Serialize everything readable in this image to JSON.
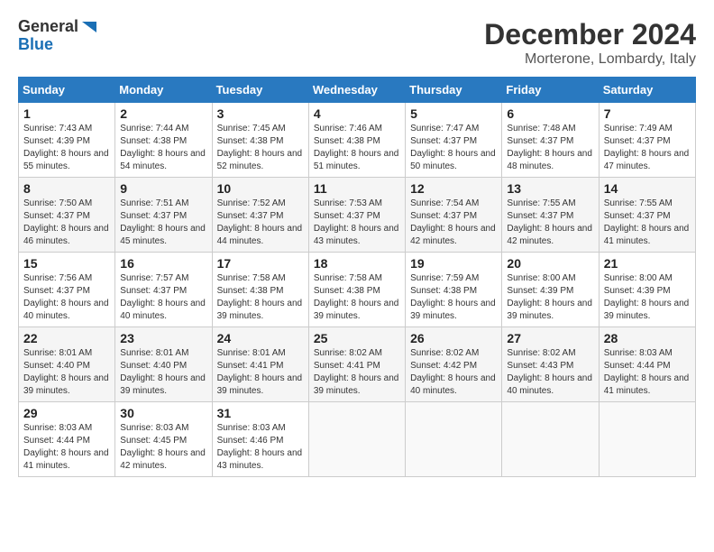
{
  "logo": {
    "line1": "General",
    "line2": "Blue"
  },
  "title": {
    "month_year": "December 2024",
    "location": "Morterone, Lombardy, Italy"
  },
  "weekdays": [
    "Sunday",
    "Monday",
    "Tuesday",
    "Wednesday",
    "Thursday",
    "Friday",
    "Saturday"
  ],
  "weeks": [
    [
      {
        "day": "1",
        "sunrise": "7:43 AM",
        "sunset": "4:39 PM",
        "daylight": "8 hours and 55 minutes."
      },
      {
        "day": "2",
        "sunrise": "7:44 AM",
        "sunset": "4:38 PM",
        "daylight": "8 hours and 54 minutes."
      },
      {
        "day": "3",
        "sunrise": "7:45 AM",
        "sunset": "4:38 PM",
        "daylight": "8 hours and 52 minutes."
      },
      {
        "day": "4",
        "sunrise": "7:46 AM",
        "sunset": "4:38 PM",
        "daylight": "8 hours and 51 minutes."
      },
      {
        "day": "5",
        "sunrise": "7:47 AM",
        "sunset": "4:37 PM",
        "daylight": "8 hours and 50 minutes."
      },
      {
        "day": "6",
        "sunrise": "7:48 AM",
        "sunset": "4:37 PM",
        "daylight": "8 hours and 48 minutes."
      },
      {
        "day": "7",
        "sunrise": "7:49 AM",
        "sunset": "4:37 PM",
        "daylight": "8 hours and 47 minutes."
      }
    ],
    [
      {
        "day": "8",
        "sunrise": "7:50 AM",
        "sunset": "4:37 PM",
        "daylight": "8 hours and 46 minutes."
      },
      {
        "day": "9",
        "sunrise": "7:51 AM",
        "sunset": "4:37 PM",
        "daylight": "8 hours and 45 minutes."
      },
      {
        "day": "10",
        "sunrise": "7:52 AM",
        "sunset": "4:37 PM",
        "daylight": "8 hours and 44 minutes."
      },
      {
        "day": "11",
        "sunrise": "7:53 AM",
        "sunset": "4:37 PM",
        "daylight": "8 hours and 43 minutes."
      },
      {
        "day": "12",
        "sunrise": "7:54 AM",
        "sunset": "4:37 PM",
        "daylight": "8 hours and 42 minutes."
      },
      {
        "day": "13",
        "sunrise": "7:55 AM",
        "sunset": "4:37 PM",
        "daylight": "8 hours and 42 minutes."
      },
      {
        "day": "14",
        "sunrise": "7:55 AM",
        "sunset": "4:37 PM",
        "daylight": "8 hours and 41 minutes."
      }
    ],
    [
      {
        "day": "15",
        "sunrise": "7:56 AM",
        "sunset": "4:37 PM",
        "daylight": "8 hours and 40 minutes."
      },
      {
        "day": "16",
        "sunrise": "7:57 AM",
        "sunset": "4:37 PM",
        "daylight": "8 hours and 40 minutes."
      },
      {
        "day": "17",
        "sunrise": "7:58 AM",
        "sunset": "4:38 PM",
        "daylight": "8 hours and 39 minutes."
      },
      {
        "day": "18",
        "sunrise": "7:58 AM",
        "sunset": "4:38 PM",
        "daylight": "8 hours and 39 minutes."
      },
      {
        "day": "19",
        "sunrise": "7:59 AM",
        "sunset": "4:38 PM",
        "daylight": "8 hours and 39 minutes."
      },
      {
        "day": "20",
        "sunrise": "8:00 AM",
        "sunset": "4:39 PM",
        "daylight": "8 hours and 39 minutes."
      },
      {
        "day": "21",
        "sunrise": "8:00 AM",
        "sunset": "4:39 PM",
        "daylight": "8 hours and 39 minutes."
      }
    ],
    [
      {
        "day": "22",
        "sunrise": "8:01 AM",
        "sunset": "4:40 PM",
        "daylight": "8 hours and 39 minutes."
      },
      {
        "day": "23",
        "sunrise": "8:01 AM",
        "sunset": "4:40 PM",
        "daylight": "8 hours and 39 minutes."
      },
      {
        "day": "24",
        "sunrise": "8:01 AM",
        "sunset": "4:41 PM",
        "daylight": "8 hours and 39 minutes."
      },
      {
        "day": "25",
        "sunrise": "8:02 AM",
        "sunset": "4:41 PM",
        "daylight": "8 hours and 39 minutes."
      },
      {
        "day": "26",
        "sunrise": "8:02 AM",
        "sunset": "4:42 PM",
        "daylight": "8 hours and 40 minutes."
      },
      {
        "day": "27",
        "sunrise": "8:02 AM",
        "sunset": "4:43 PM",
        "daylight": "8 hours and 40 minutes."
      },
      {
        "day": "28",
        "sunrise": "8:03 AM",
        "sunset": "4:44 PM",
        "daylight": "8 hours and 41 minutes."
      }
    ],
    [
      {
        "day": "29",
        "sunrise": "8:03 AM",
        "sunset": "4:44 PM",
        "daylight": "8 hours and 41 minutes."
      },
      {
        "day": "30",
        "sunrise": "8:03 AM",
        "sunset": "4:45 PM",
        "daylight": "8 hours and 42 minutes."
      },
      {
        "day": "31",
        "sunrise": "8:03 AM",
        "sunset": "4:46 PM",
        "daylight": "8 hours and 43 minutes."
      },
      null,
      null,
      null,
      null
    ]
  ],
  "labels": {
    "sunrise": "Sunrise:",
    "sunset": "Sunset:",
    "daylight": "Daylight:"
  }
}
